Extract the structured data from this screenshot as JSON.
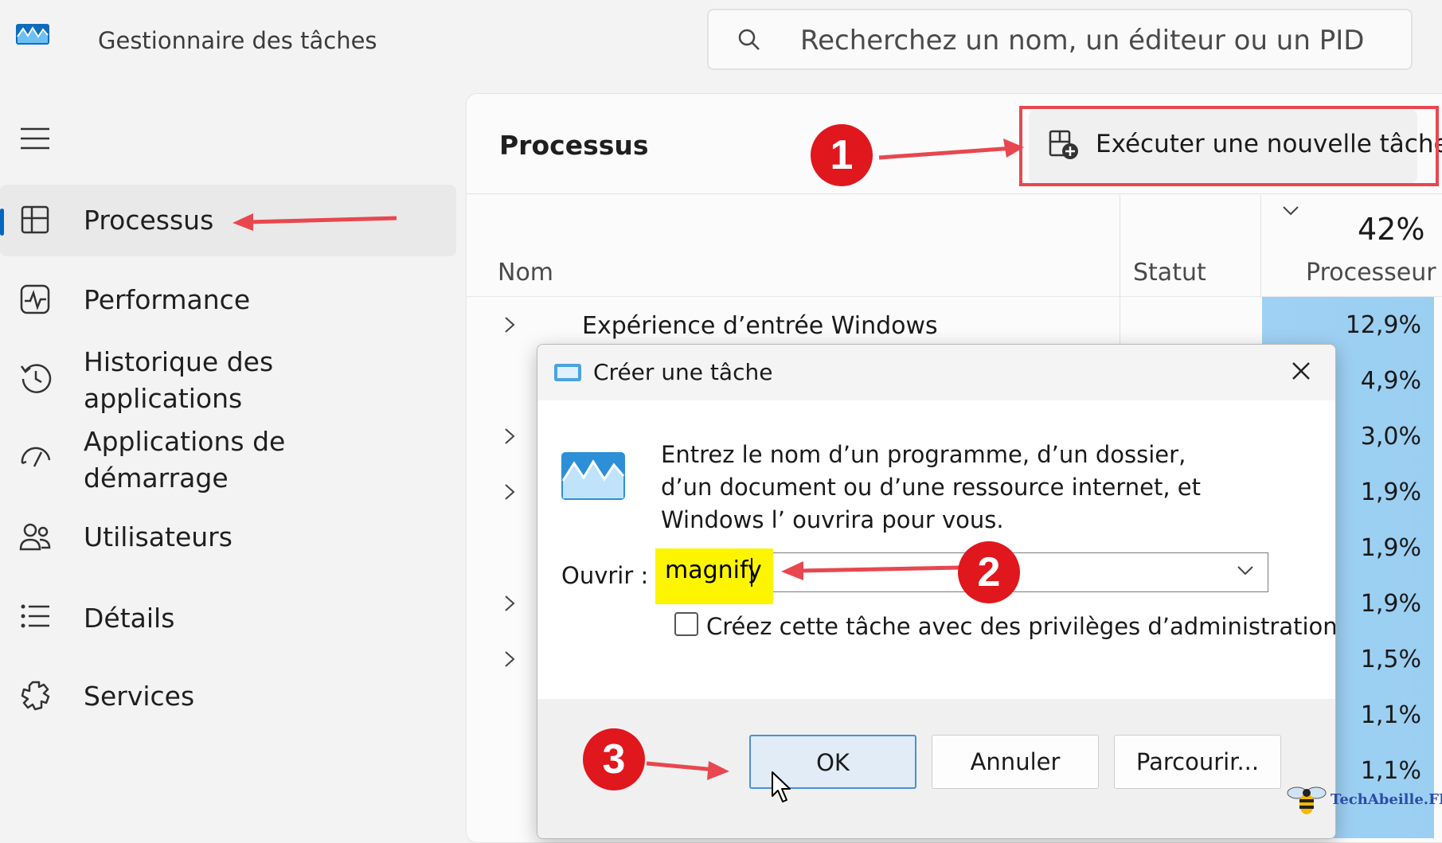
{
  "app": {
    "title": "Gestionnaire des tâches",
    "search_placeholder": "Recherchez un nom, un éditeur ou un PID"
  },
  "sidebar": {
    "items": [
      {
        "label": "Processus",
        "icon": "processes-icon",
        "active": true
      },
      {
        "label": "Performance",
        "icon": "performance-icon"
      },
      {
        "label": "Historique des applications",
        "icon": "history-icon"
      },
      {
        "label": "Applications de démarrage",
        "icon": "startup-icon"
      },
      {
        "label": "Utilisateurs",
        "icon": "users-icon"
      },
      {
        "label": "Détails",
        "icon": "details-icon"
      },
      {
        "label": "Services",
        "icon": "services-icon"
      }
    ]
  },
  "main": {
    "title": "Processus",
    "run_task_label": "Exécuter une nouvelle tâche",
    "columns": {
      "name": "Nom",
      "status": "Statut",
      "cpu": "Processeur",
      "cpu_total": "42%"
    },
    "rows": [
      {
        "name": "Expérience d’entrée Windows",
        "cpu": "12,9%"
      },
      {
        "name": "",
        "cpu": "4,9%"
      },
      {
        "name": "",
        "cpu": "3,0%"
      },
      {
        "name": "",
        "cpu": "1,9%"
      },
      {
        "name": "",
        "cpu": "1,9%"
      },
      {
        "name": "",
        "cpu": "1,9%"
      },
      {
        "name": "",
        "cpu": "1,5%"
      },
      {
        "name": "",
        "cpu": "1,1%"
      },
      {
        "name": "",
        "cpu": "1,1%"
      }
    ]
  },
  "dialog": {
    "title": "Créer une tâche",
    "description": "Entrez le nom d’un programme, d’un dossier, d’un document ou d’une ressource internet, et Windows l’ ouvrira pour vous.",
    "open_label": "Ouvrir :",
    "open_value": "magnify",
    "admin_checkbox_label": "Créez cette tâche avec des privilèges d’administration.",
    "admin_checked": false,
    "buttons": {
      "ok": "OK",
      "cancel": "Annuler",
      "browse": "Parcourir..."
    }
  },
  "annotations": {
    "step1": "1",
    "step2": "2",
    "step3": "3",
    "accent": "#e1171e"
  },
  "watermark": {
    "text": "TechAbeille.FR"
  }
}
